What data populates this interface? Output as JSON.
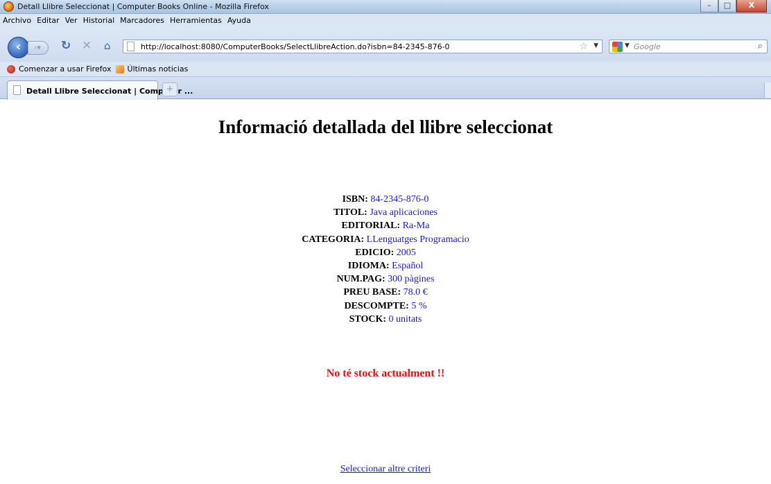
{
  "window": {
    "title": "Detall Llibre Seleccionat | Computer Books Online - Mozilla Firefox",
    "minimize": "–",
    "maximize": "□",
    "close": "X"
  },
  "menu": [
    "Archivo",
    "Editar",
    "Ver",
    "Historial",
    "Marcadores",
    "Herramientas",
    "Ayuda"
  ],
  "nav": {
    "url": "http://localhost:8080/ComputerBooks/SelectLlibreAction.do?isbn=84-2345-876-0",
    "search_placeholder": "Google"
  },
  "bookmarks": [
    "Comenzar a usar Firefox",
    "Últimas noticias"
  ],
  "tab": {
    "label": "Detall Llibre Seleccionat | Computer ...",
    "new_tab": "+"
  },
  "page": {
    "heading": "Informació detallada del llibre seleccionat",
    "fields": [
      {
        "label": "ISBN:",
        "value": "84-2345-876-0"
      },
      {
        "label": "TITOL:",
        "value": "Java aplicaciones"
      },
      {
        "label": "EDITORIAL:",
        "value": "Ra-Ma"
      },
      {
        "label": "CATEGORIA:",
        "value": "LLenguatges Programacio"
      },
      {
        "label": "EDICIO:",
        "value": "2005"
      },
      {
        "label": "IDIOMA:",
        "value": "Español"
      },
      {
        "label": "NUM.PAG:",
        "value": "300 pàgines"
      },
      {
        "label": "PREU BASE:",
        "value": "78.0 €"
      },
      {
        "label": "DESCOMPTE:",
        "value": "5 %"
      },
      {
        "label": "STOCK:",
        "value": "0 unitats"
      }
    ],
    "warning": "No té stock actualment !!",
    "link": "Seleccionar altre criteri"
  }
}
